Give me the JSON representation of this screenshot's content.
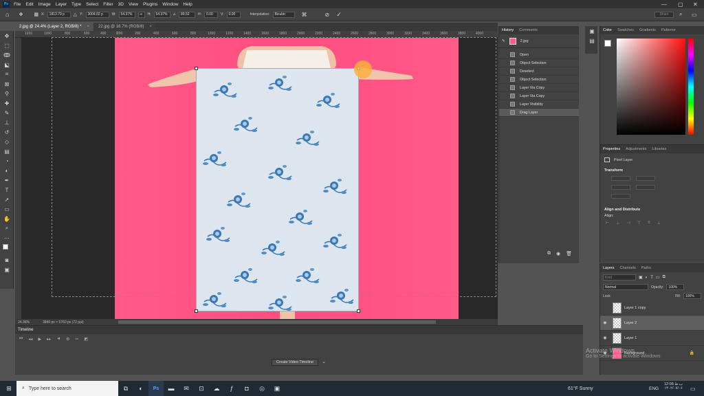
{
  "menubar": {
    "app_icon": "Ps",
    "items": [
      "File",
      "Edit",
      "Image",
      "Layer",
      "Type",
      "Select",
      "Filter",
      "3D",
      "View",
      "Plugins",
      "Window",
      "Help"
    ],
    "min_icon": "minimize-icon",
    "max_icon": "maximize-icon",
    "close_icon": "close-icon"
  },
  "options": {
    "x_label": "X:",
    "x_value": "1813.79 p",
    "y_label": "Y:",
    "y_value": "3004.02 p",
    "w_label": "W:",
    "w_value": "54.37%",
    "h_label": "H:",
    "h_value": "54.37%",
    "angle_value": "89.52",
    "h2_label": "H:",
    "h2_value": "0.00",
    "v_label": "V:",
    "v_value": "0.00",
    "interp_label": "Interpolation:",
    "interp_value": "Bicubic",
    "search_label": "Share"
  },
  "tabs": [
    {
      "label": "2.jpg @ 24.4% (Layer 2, RGB/8) *"
    },
    {
      "label": "22.jpg @ 16.7% (RGB/8)"
    }
  ],
  "ruler": {
    "top_ticks": [
      "1200",
      "1000",
      "800",
      "600",
      "400",
      "200",
      "0",
      "200",
      "400",
      "600",
      "800",
      "1000",
      "1200",
      "1400",
      "1600",
      "1800",
      "2000",
      "2200",
      "2400",
      "2600",
      "2800",
      "3000",
      "3200",
      "3400",
      "3600",
      "3800",
      "4000"
    ]
  },
  "statusbar": {
    "zoom": "24.36%",
    "doc_info": "3840 px × 5760 px (72 ppi)"
  },
  "timeline": {
    "title": "Timeline",
    "create_button": "Create Video Timeline"
  },
  "history": {
    "tabs": [
      "History",
      "Comments"
    ],
    "snapshot": "2.jpg",
    "steps": [
      "Open",
      "Object Selection",
      "Deselect",
      "Object Selection",
      "Layer Via Copy",
      "Layer Via Copy",
      "Layer Visibility",
      "Drag Layer"
    ]
  },
  "color": {
    "tabs": [
      "Color",
      "Swatches",
      "Gradients",
      "Patterns"
    ]
  },
  "properties": {
    "tabs": [
      "Properties",
      "Adjustments",
      "Libraries"
    ],
    "kind": "Pixel Layer",
    "transform": "Transform",
    "align": "Align and Distribute",
    "align_label": "Align:"
  },
  "layers": {
    "tabs": [
      "Layers",
      "Channels",
      "Paths"
    ],
    "kind_placeholder": "Kind",
    "blend": "Normal",
    "opacity_label": "Opacity:",
    "opacity": "100%",
    "lock_label": "Lock:",
    "fill_label": "Fill:",
    "fill": "100%",
    "rows": [
      {
        "name": "Layer 1 copy"
      },
      {
        "name": "Layer 2"
      },
      {
        "name": "Layer 1"
      },
      {
        "name": "Background"
      }
    ]
  },
  "watermark": {
    "line1": "Activate Windows",
    "line2": "Go to Settings to activate Windows"
  },
  "taskbar": {
    "search_placeholder": "Type here to search",
    "weather": "61°F  Sunny",
    "lang": "ENG",
    "time": "12:08 ب.ظ",
    "date": "۱۴۰۲/۰۷/۰۶"
  }
}
